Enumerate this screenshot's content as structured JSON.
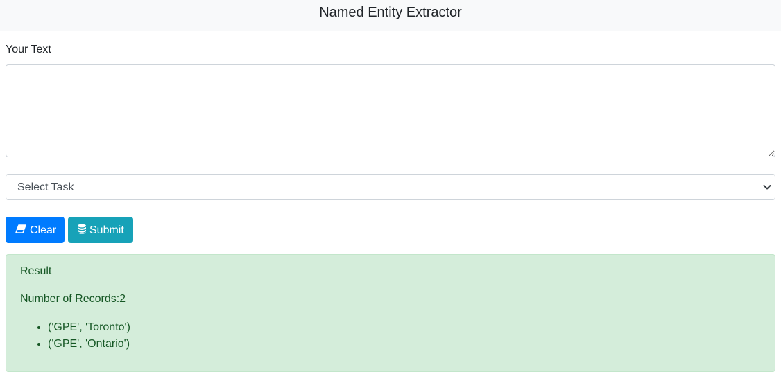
{
  "header": {
    "title": "Named Entity Extractor"
  },
  "form": {
    "text_label": "Your Text",
    "text_value": "",
    "task_select": {
      "selected": "Select Task"
    }
  },
  "buttons": {
    "clear": {
      "label": "Clear",
      "icon": "eraser-icon",
      "color": "#007bff"
    },
    "submit": {
      "label": "Submit",
      "icon": "database-icon",
      "color": "#17a2b8"
    }
  },
  "result": {
    "title": "Result",
    "count_text": "Number of Records:2",
    "records": [
      "('GPE', 'Toronto')",
      "('GPE', 'Ontario')"
    ],
    "background_color": "#d4edda",
    "text_color": "#155724"
  }
}
